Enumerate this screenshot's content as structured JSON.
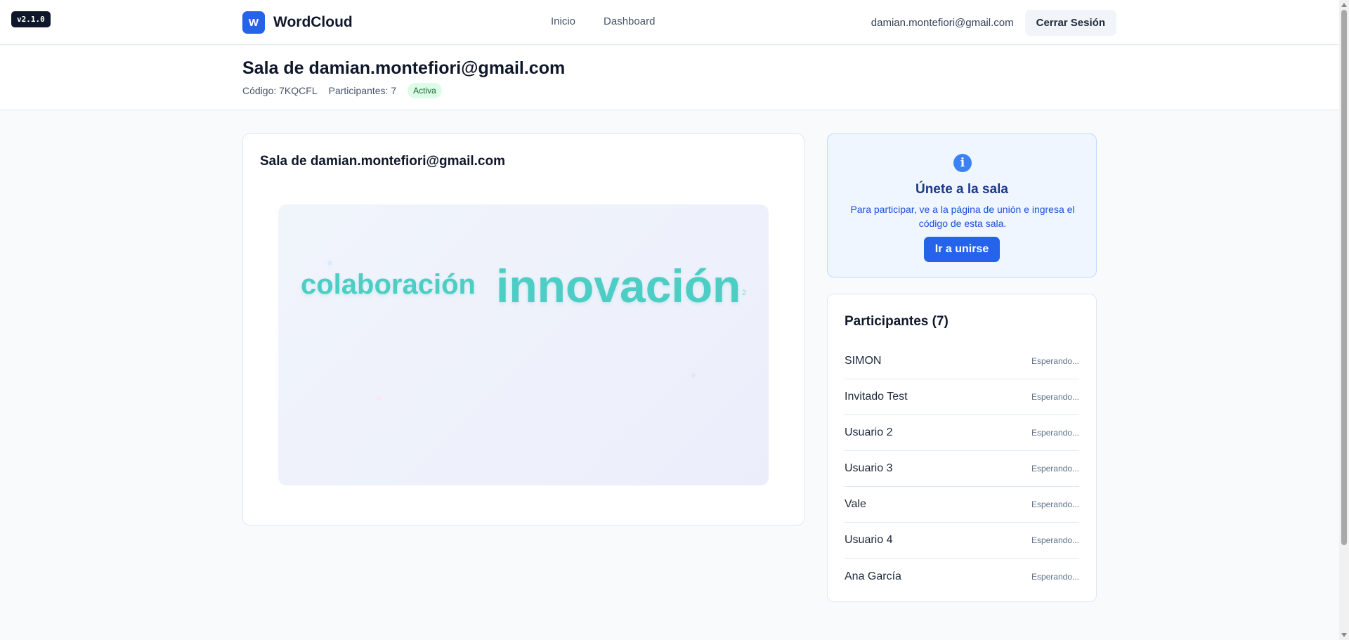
{
  "version": "v2.1.0",
  "header": {
    "logo_letter": "W",
    "brand": "WordCloud",
    "nav": [
      "Inicio",
      "Dashboard"
    ],
    "user_email": "damian.montefiori@gmail.com",
    "logout_label": "Cerrar Sesión"
  },
  "room": {
    "title": "Sala de damian.montefiori@gmail.com",
    "code_text": "Código: 7KQCFL",
    "participants_text": "Participantes: 7",
    "status": "Activa"
  },
  "cloud": {
    "title": "Sala de damian.montefiori@gmail.com",
    "words": [
      {
        "text": "colaboración"
      },
      {
        "text": "innovación"
      },
      {
        "text": "2"
      }
    ],
    "word_color": "#4ecdc4"
  },
  "join": {
    "icon": "info-icon",
    "title": "Únete a la sala",
    "description": "Para participar, ve a la página de unión e ingresa el código de esta sala.",
    "button_label": "Ir a unirse"
  },
  "participants": {
    "title": "Participantes (7)",
    "items": [
      {
        "name": "SIMON",
        "status": "Esperando..."
      },
      {
        "name": "Invitado Test",
        "status": "Esperando..."
      },
      {
        "name": "Usuario 2",
        "status": "Esperando..."
      },
      {
        "name": "Usuario 3",
        "status": "Esperando..."
      },
      {
        "name": "Vale",
        "status": "Esperando..."
      },
      {
        "name": "Usuario 4",
        "status": "Esperando..."
      },
      {
        "name": "Ana García",
        "status": "Esperando..."
      }
    ]
  },
  "colors": {
    "primary": "#2563eb",
    "status_active_bg": "#dcfce7",
    "status_active_text": "#166534"
  }
}
